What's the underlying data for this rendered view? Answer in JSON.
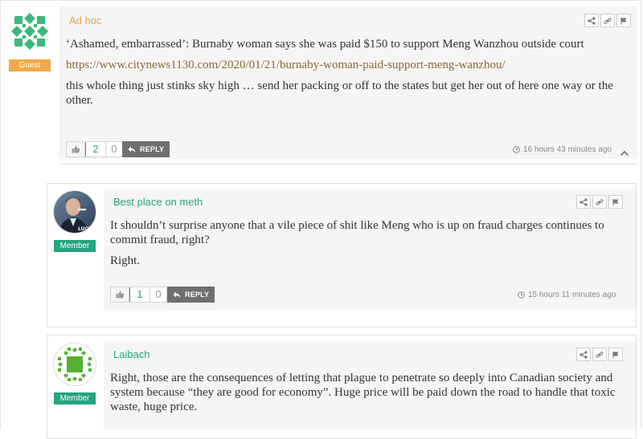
{
  "comments": [
    {
      "author": "Ad hoc",
      "role": "Guest",
      "headline": "‘Ashamed, embarrassed’: Burnaby woman says she was paid $150 to support Meng Wanzhou outside court",
      "link": "https://www.citynews1130.com/2020/01/21/burnaby-woman-paid-support-meng-wanzhou/",
      "body": "this whole thing just stinks sky high … send her packing or off to the states but get her out of here one way or the other.",
      "likes": "2",
      "dislikes": "0",
      "reply_label": "REPLY",
      "time": "16 hours 43 minutes ago"
    },
    {
      "author": "Best place on meth",
      "role": "Member",
      "body": "It shouldn’t surprise anyone that a vile piece of shit like Meng who is up on fraud charges continues to commit fraud, right?",
      "body2": "Right.",
      "likes": "1",
      "dislikes": "0",
      "reply_label": "REPLY",
      "time": "15 hours 11 minutes ago"
    },
    {
      "author": "Laibach",
      "role": "Member",
      "body": "Right, those are the consequences of letting that plague to penetrate so deeply into Canadian society and system because “they are good for economy”. Huge price will be paid down the road to handle that toxic waste, huge price."
    }
  ],
  "colors": {
    "guest": "#f2a845",
    "member": "#24a47f",
    "link": "#8a6a2e"
  }
}
